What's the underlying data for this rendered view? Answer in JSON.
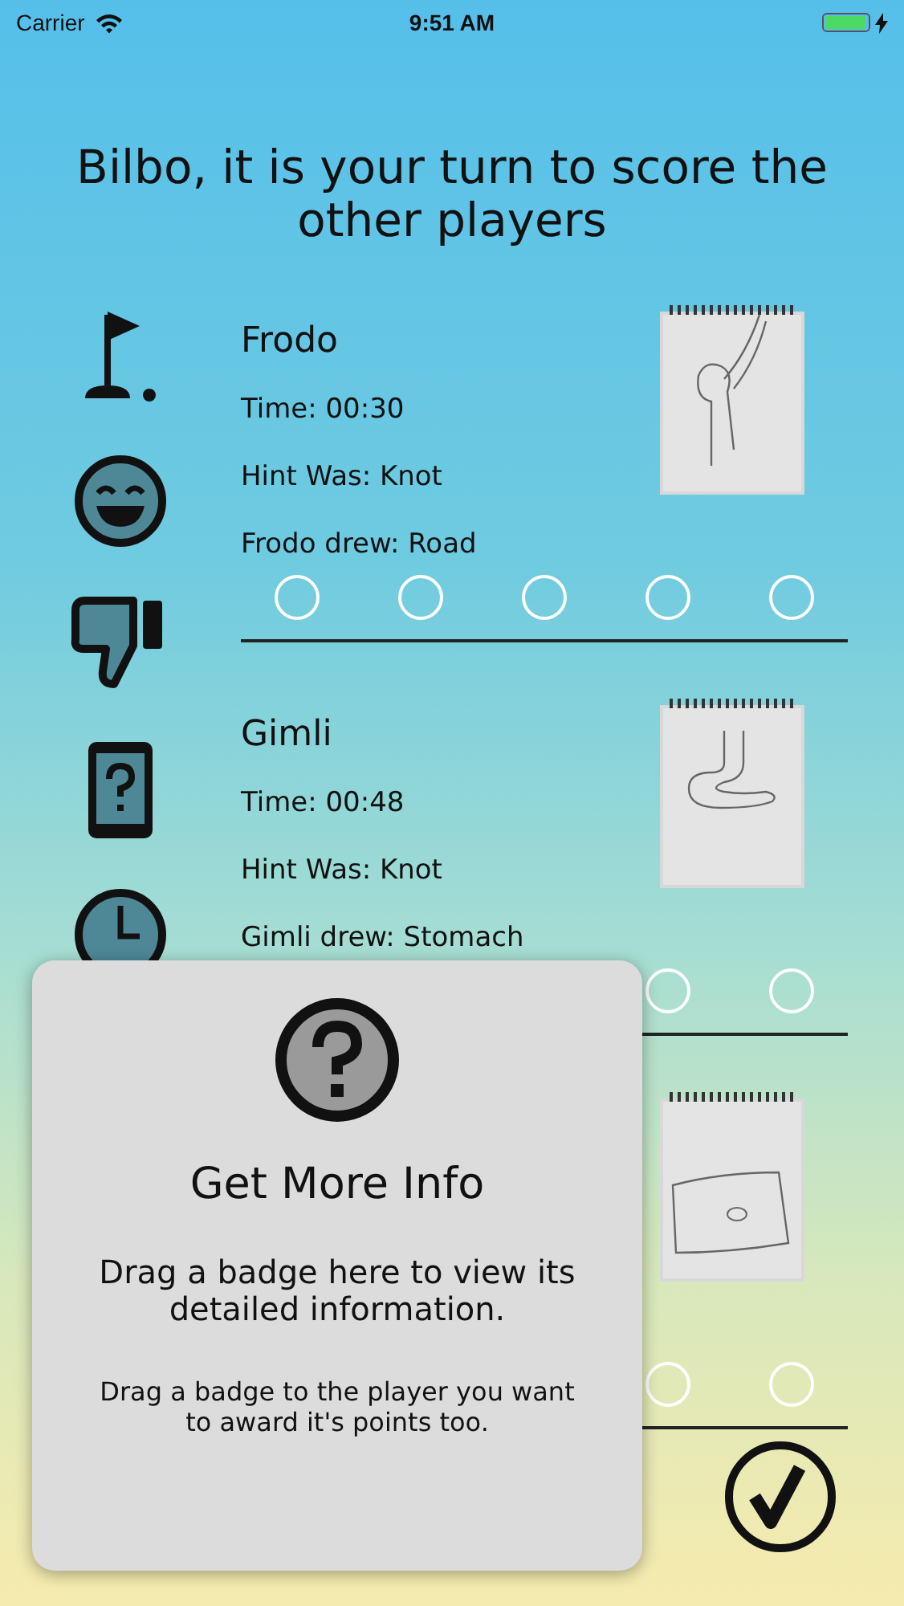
{
  "status_bar": {
    "carrier": "Carrier",
    "time": "9:51 AM",
    "charging": true,
    "battery": {
      "level": 0.95
    }
  },
  "title": "Bilbo, it is your turn to score the other players",
  "badges": [
    {
      "kind": "flag"
    },
    {
      "kind": "smiley"
    },
    {
      "kind": "thumbs-down"
    },
    {
      "kind": "phone-question"
    },
    {
      "kind": "clock"
    }
  ],
  "players": [
    {
      "name": "Frodo",
      "time": "Time: 00:30",
      "hint": "Hint Was: Knot",
      "drew": "Frodo drew: Road",
      "drawing": {
        "kind": "picture"
      },
      "scores": [
        {
          "selected": false
        },
        {
          "selected": false
        },
        {
          "selected": false
        },
        {
          "selected": false
        },
        {
          "selected": false
        }
      ]
    },
    {
      "name": "Gimli",
      "time": "Time: 00:48",
      "hint": "Hint Was: Knot",
      "drew": "Gimli drew: Stomach",
      "drawing": {
        "kind": "picture"
      },
      "scores": [
        {
          "selected": false
        },
        {
          "selected": false
        }
      ]
    },
    {
      "drawing": {
        "kind": "picture"
      },
      "scores": [
        {
          "selected": false
        },
        {
          "selected": false
        }
      ]
    }
  ],
  "info_panel": {
    "title": "Get More Info",
    "text": "Drag a badge here to view its detailed information.",
    "note": "Drag a badge to the player you want to award it's points too."
  },
  "done_button": {
    "kind": "check"
  }
}
